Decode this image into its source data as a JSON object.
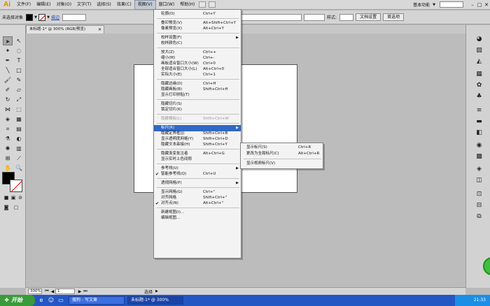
{
  "app": {
    "logo": "Ai"
  },
  "menubar": {
    "items": [
      "文件(F)",
      "编辑(E)",
      "对象(O)",
      "文字(T)",
      "选择(S)",
      "效果(C)",
      "视图(V)",
      "窗口(W)",
      "帮助(H)"
    ],
    "active_index": 6,
    "essentials": "基本功能",
    "window_controls": [
      "–",
      "□",
      "✕"
    ]
  },
  "controlbar": {
    "selection_label": "未选择对象",
    "stroke_label": "描边",
    "style_label": "样式:",
    "doc_setup_button": "文档设置",
    "preferences_button": "首选项"
  },
  "document": {
    "tab_title": "未标题-1* @ 300% (RGB/预览)",
    "tab_close": "✕"
  },
  "statusbar": {
    "zoom": "300%",
    "page": "1",
    "status": "选择"
  },
  "taskbar": {
    "start": "开始",
    "tasks": [
      "搜狗 - 写文章",
      "未标题-1* @ 300%"
    ],
    "active_task": 1,
    "clock": "21:33"
  },
  "view_menu": {
    "items": [
      {
        "label": "轮廓(O)",
        "shortcut": "Ctrl+Y",
        "type": "item"
      },
      {
        "type": "sep"
      },
      {
        "label": "叠印预览(V)",
        "shortcut": "Alt+Shift+Ctrl+Y",
        "type": "item"
      },
      {
        "label": "像素预览(X)",
        "shortcut": "Alt+Ctrl+Y",
        "type": "item"
      },
      {
        "type": "sep"
      },
      {
        "label": "校样设置(F)",
        "shortcut": "",
        "type": "submenu"
      },
      {
        "label": "校样颜色(C)",
        "shortcut": "",
        "type": "item"
      },
      {
        "type": "sep"
      },
      {
        "label": "放大(Z)",
        "shortcut": "Ctrl++",
        "type": "item"
      },
      {
        "label": "缩小(M)",
        "shortcut": "Ctrl+-",
        "type": "item"
      },
      {
        "label": "画板适合窗口大小(W)",
        "shortcut": "Ctrl+0",
        "type": "item"
      },
      {
        "label": "全部适合窗口大小(L)",
        "shortcut": "Alt+Ctrl+0",
        "type": "item"
      },
      {
        "label": "实际大小(E)",
        "shortcut": "Ctrl+1",
        "type": "item"
      },
      {
        "type": "sep"
      },
      {
        "label": "隐藏边缘(D)",
        "shortcut": "Ctrl+H",
        "type": "item"
      },
      {
        "label": "隐藏画板(B)",
        "shortcut": "Shift+Ctrl+H",
        "type": "item"
      },
      {
        "label": "显示打印拼贴(T)",
        "shortcut": "",
        "type": "item"
      },
      {
        "type": "sep"
      },
      {
        "label": "隐藏切片(S)",
        "shortcut": "",
        "type": "item"
      },
      {
        "label": "锁定切片(K)",
        "shortcut": "",
        "type": "item"
      },
      {
        "type": "sep"
      },
      {
        "label": "隐藏模板(L)",
        "shortcut": "Shift+Ctrl+W",
        "type": "disabled"
      },
      {
        "type": "sep"
      },
      {
        "label": "标尺(R)",
        "shortcut": "",
        "type": "highlight"
      },
      {
        "label": "隐藏定界框(J)",
        "shortcut": "Shift+Ctrl+B",
        "type": "item"
      },
      {
        "label": "显示透明度网格(Y)",
        "shortcut": "Shift+Ctrl+D",
        "type": "item"
      },
      {
        "label": "隐藏文本串接(H)",
        "shortcut": "Shift+Ctrl+Y",
        "type": "item"
      },
      {
        "type": "sep"
      },
      {
        "label": "隐藏渐变批注者",
        "shortcut": "Alt+Ctrl+G",
        "type": "item"
      },
      {
        "label": "显示实时上色间隙",
        "shortcut": "",
        "type": "item"
      },
      {
        "type": "sep"
      },
      {
        "label": "参考线(U)",
        "shortcut": "",
        "type": "submenu"
      },
      {
        "label": "智能参考线(Q)",
        "shortcut": "Ctrl+U",
        "type": "checked"
      },
      {
        "type": "sep"
      },
      {
        "label": "透视网格(P)",
        "shortcut": "",
        "type": "submenu"
      },
      {
        "type": "sep"
      },
      {
        "label": "显示网格(G)",
        "shortcut": "Ctrl+\"",
        "type": "item"
      },
      {
        "label": "对齐网格",
        "shortcut": "Shift+Ctrl+\"",
        "type": "item"
      },
      {
        "label": "对齐点(N)",
        "shortcut": "Alt+Ctrl+\"",
        "type": "checked"
      },
      {
        "type": "sep"
      },
      {
        "label": "新建视图(I)...",
        "shortcut": "",
        "type": "item"
      },
      {
        "label": "编辑视图...",
        "shortcut": "",
        "type": "item"
      }
    ]
  },
  "rulers_submenu": {
    "items": [
      {
        "label": "显示标尺(S)",
        "shortcut": "Ctrl+R"
      },
      {
        "label": "更改为全局标尺(C)",
        "shortcut": "Alt+Ctrl+R"
      },
      {
        "type": "sep"
      },
      {
        "label": "显示视频标尺(V)",
        "shortcut": ""
      }
    ]
  }
}
